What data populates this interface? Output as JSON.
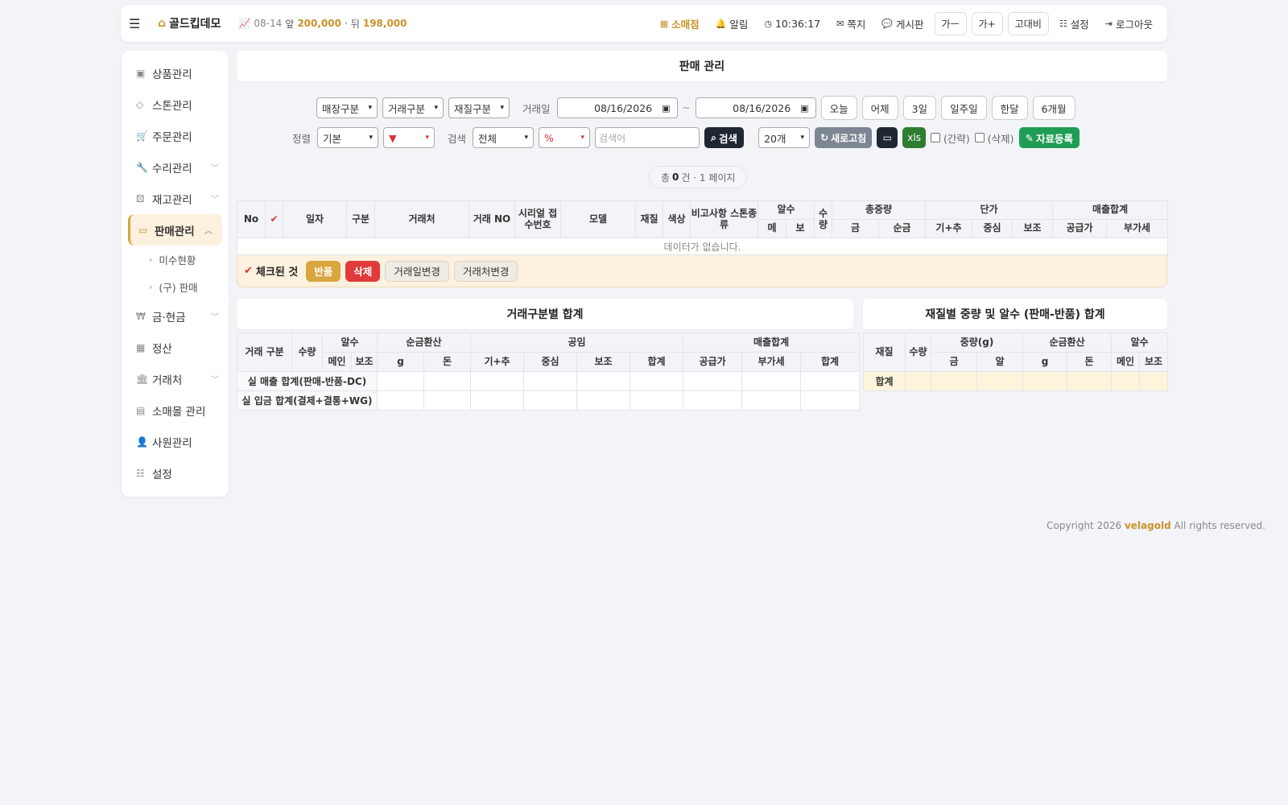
{
  "header": {
    "brand": "골드킵데모",
    "ticker_date": "08-14",
    "ticker_front_label": "앞",
    "ticker_front_value": "200,000",
    "ticker_sep": "·",
    "ticker_back_label": "뒤",
    "ticker_back_value": "198,000",
    "store": "소매점",
    "alert": "알림",
    "time": "10:36:17",
    "message": "쪽지",
    "board": "게시판",
    "font_minus": "가ㅡ",
    "font_plus": "가+",
    "contrast": "고대비",
    "settings": "설정",
    "logout": "로그아웃"
  },
  "sidebar": {
    "items": [
      {
        "label": "상품관리",
        "icon": "image-icon",
        "chev": false
      },
      {
        "label": "스톤관리",
        "icon": "diamond-icon",
        "chev": false
      },
      {
        "label": "주문관리",
        "icon": "cart-icon",
        "chev": false
      },
      {
        "label": "수리관리",
        "icon": "wrench-icon",
        "chev": true
      },
      {
        "label": "재고관리",
        "icon": "cubes-icon",
        "chev": true
      },
      {
        "label": "판매관리",
        "icon": "credit-card-icon",
        "chev": true,
        "active": true
      },
      {
        "label": "금·현금",
        "icon": "won-icon",
        "chev": true
      },
      {
        "label": "정산",
        "icon": "calculator-icon",
        "chev": false
      },
      {
        "label": "거래처",
        "icon": "bank-icon",
        "chev": true
      },
      {
        "label": "소매몰 관리",
        "icon": "shop-icon",
        "chev": false
      },
      {
        "label": "사원관리",
        "icon": "user-icon",
        "chev": false
      },
      {
        "label": "설정",
        "icon": "sliders-icon",
        "chev": false
      }
    ],
    "sub_items": [
      "미수현황",
      "(구) 판매"
    ]
  },
  "main": {
    "title": "판매 관리",
    "filters": {
      "store_type": "매장구분",
      "trade_type": "거래구분",
      "material_type": "재질구분",
      "date_label": "거래일",
      "date_from": "08/16/2026",
      "tilde": "~",
      "date_to": "08/16/2026",
      "quick": [
        "오늘",
        "어제",
        "3일",
        "일주일",
        "한달",
        "6개월"
      ],
      "sort_label": "정렬",
      "sort_value": "기본",
      "sort_dir": "▼",
      "search_label": "검색",
      "search_field": "전체",
      "search_op": "%",
      "search_placeholder": "검색어",
      "search_button": "검색",
      "page_size": "20개",
      "refresh": "새로고침",
      "xls": "xls",
      "brief": "(간략)",
      "deleted": "(삭제)",
      "register": "자료등록"
    },
    "count": {
      "prefix": "총",
      "total": "0",
      "suffix": "건 · 1 페이지"
    },
    "grid": {
      "h_no": "No",
      "h_date": "일자",
      "h_type": "구분",
      "h_partner": "거래처",
      "h_trade_no": "거래 NO",
      "h_serial": "시리얼 접수번호",
      "h_model": "모델",
      "h_material": "재질",
      "h_color": "색상",
      "h_remark": "비고사항 스톤종류",
      "h_stone": "알수",
      "h_stone_main": "메",
      "h_stone_sub": "보",
      "h_qty": "수량",
      "h_weight": "총중량",
      "h_gold": "금",
      "h_pure": "순금",
      "h_price": "단가",
      "h_base": "기+추",
      "h_center": "중심",
      "h_aux": "보조",
      "h_sales": "매출합계",
      "h_supply": "공급가",
      "h_vat": "부가세",
      "empty": "데이터가 없습니다."
    },
    "actions": {
      "label": "체크된 것",
      "return": "반품",
      "delete": "삭제",
      "change_date": "거래일변경",
      "change_partner": "거래처변경"
    },
    "sum_left": {
      "title": "거래구분별 합계",
      "h_type": "거래 구분",
      "h_qty": "수량",
      "h_stone": "알수",
      "h_main": "메인",
      "h_aux": "보조",
      "h_pure": "순금환산",
      "h_g": "g",
      "h_don": "돈",
      "h_labor": "공임",
      "h_base": "기+추",
      "h_center": "중심",
      "h_aux2": "보조",
      "h_sum": "합계",
      "h_sales": "매출합계",
      "h_supply": "공급가",
      "h_vat": "부가세",
      "h_total": "합계",
      "row1": "실 매출 합계(판매-반품-DC)",
      "row2": "실 입금 합계(결제+결통+WG)"
    },
    "sum_right": {
      "title": "재질별 중량 및 알수 (판매-반품) 합계",
      "h_material": "재질",
      "h_qty": "수량",
      "h_weight": "중량(g)",
      "h_gold": "금",
      "h_stone_w": "알",
      "h_pure": "순금환산",
      "h_g": "g",
      "h_don": "돈",
      "h_stone": "알수",
      "h_main": "메인",
      "h_aux": "보조",
      "row_total": "합계"
    }
  },
  "footer": {
    "prefix": "Copyright 2026",
    "brand": "velagold",
    "suffix": "All rights reserved."
  },
  "colors": {
    "accent": "#c9922a",
    "active_bg": "#fbf1de",
    "danger": "#e03a3a",
    "success": "#1f9d55",
    "dark": "#1f2733"
  }
}
